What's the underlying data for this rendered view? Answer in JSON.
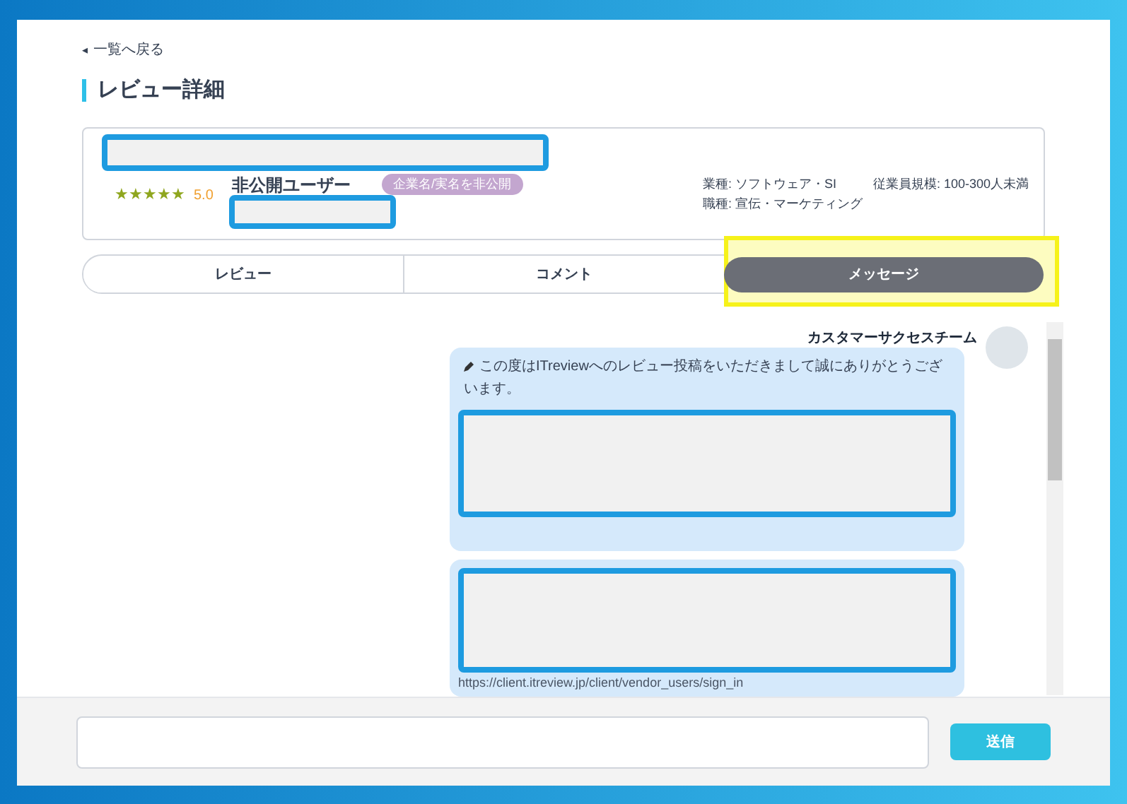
{
  "back_link": {
    "icon": "◂",
    "label": "一覧へ戻る"
  },
  "title": "レビュー詳細",
  "review_card": {
    "stars": 5,
    "score": "5.0",
    "user": "非公開ユーザー",
    "badge": "企業名/実名を非公開",
    "details": [
      "業種: ソフトウェア・SI",
      "従業員規模: 100-300人未満",
      "職種: 宣伝・マーケティング"
    ]
  },
  "tabs": [
    {
      "label": "レビュー",
      "selected": false,
      "highlighted": false
    },
    {
      "label": "コメント",
      "selected": false,
      "highlighted": false
    },
    {
      "label": "メッセージ",
      "selected": true,
      "highlighted": true
    }
  ],
  "message": {
    "sender": "カスタマーサクセスチーム",
    "text": "この度はITreviewへのレビュー投稿をいただきまして誠にありがとうございます。",
    "link": "https://client.itreview.jp/client/vendor_users/sign_in"
  },
  "composer": {
    "button": "送信"
  }
}
